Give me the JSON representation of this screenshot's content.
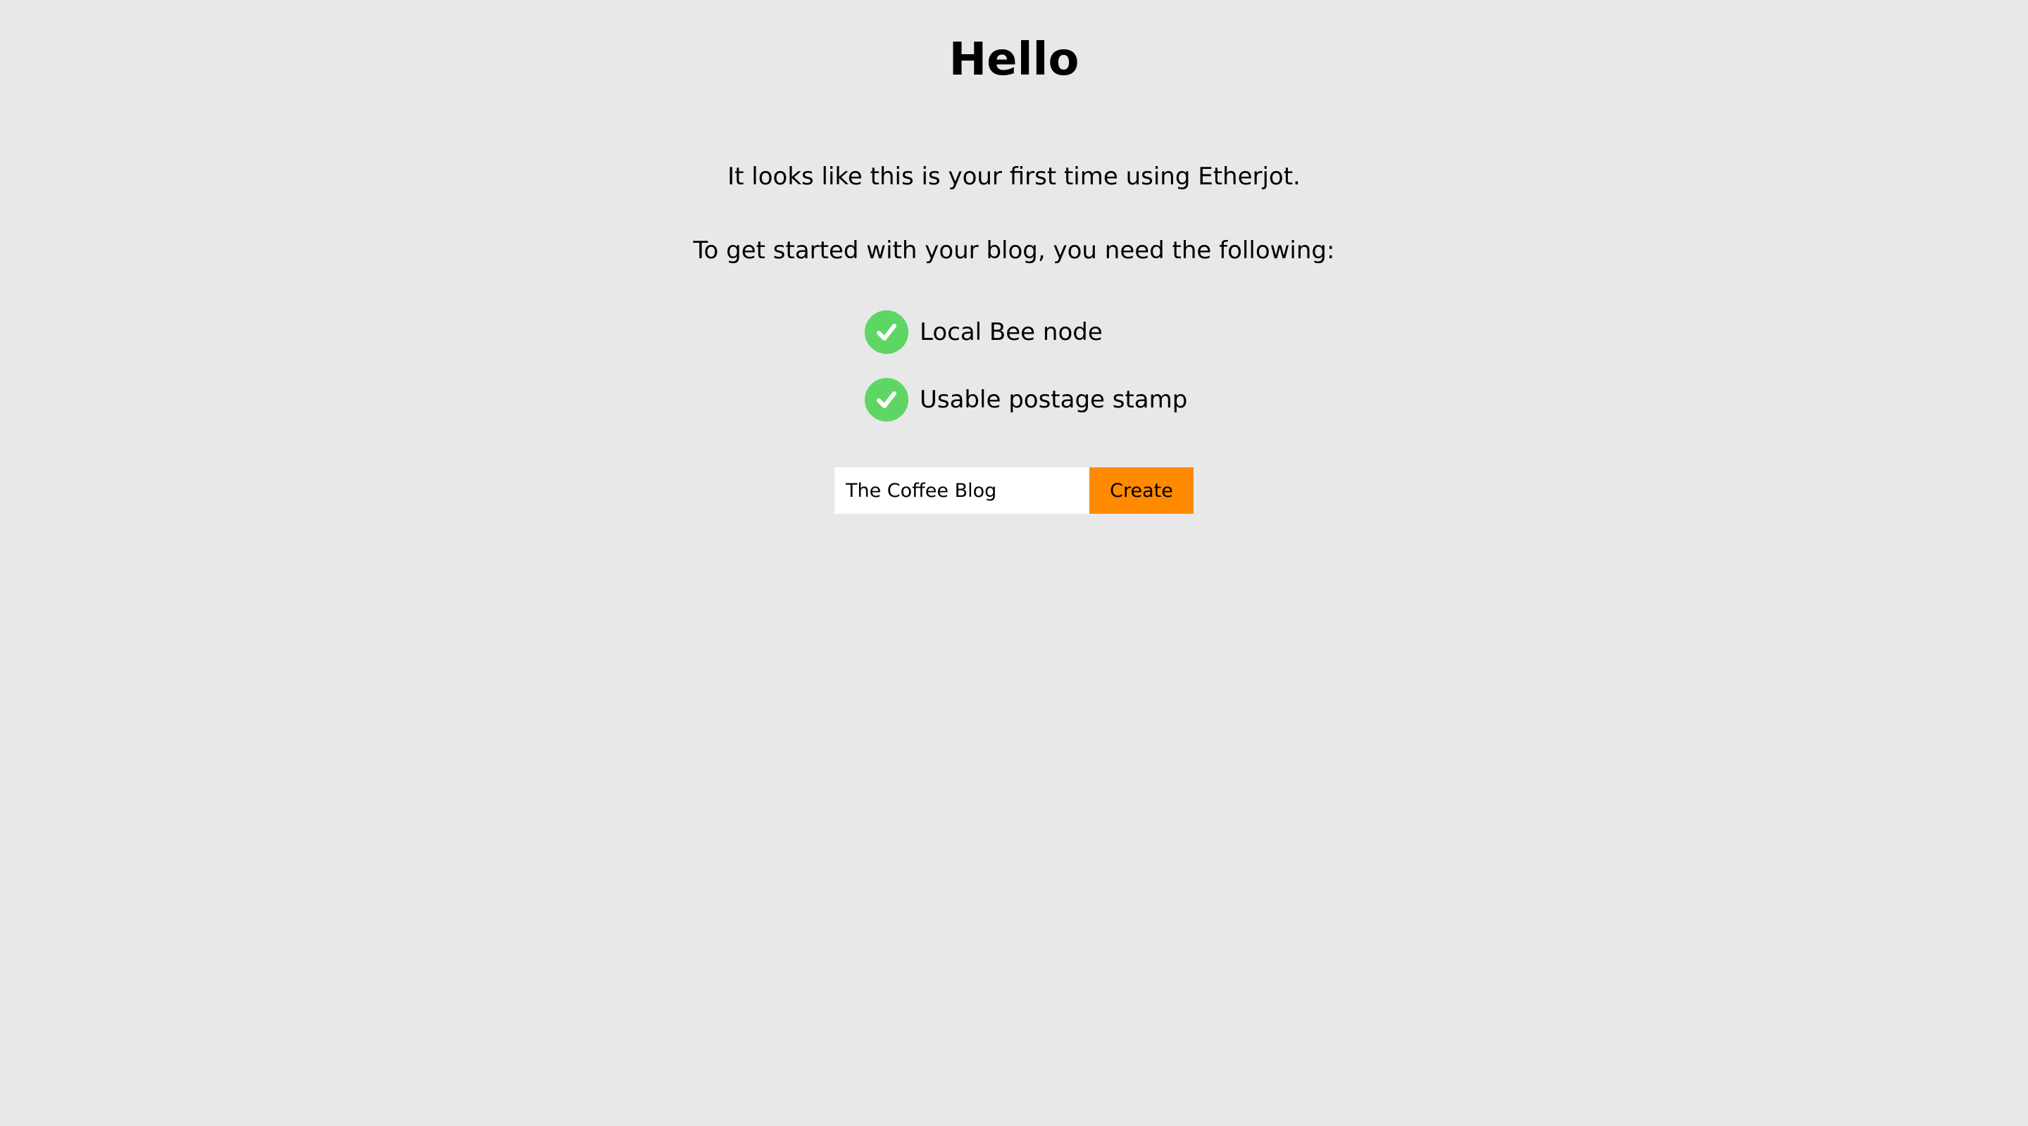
{
  "heading": "Hello",
  "intro": {
    "line1": "It looks like this is your first time using Etherjot.",
    "line2": "To get started with your blog, you need the following:"
  },
  "requirements": [
    {
      "label": "Local Bee node",
      "icon": "check-circle-icon",
      "status": "done"
    },
    {
      "label": "Usable postage stamp",
      "icon": "check-circle-icon",
      "status": "done"
    }
  ],
  "create_form": {
    "input_value": "The Coffee Blog",
    "button_label": "Create"
  },
  "colors": {
    "background": "#e8e8e8",
    "check": "#5dd663",
    "accent": "#ff8a00",
    "input_bg": "#ffffff"
  }
}
